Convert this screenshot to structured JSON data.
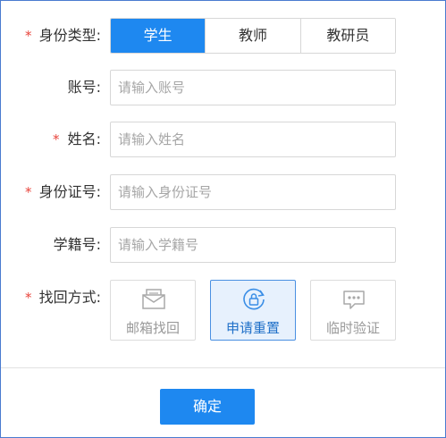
{
  "form": {
    "identity_type": {
      "label": "身份类型:",
      "required": "*",
      "options": [
        "学生",
        "教师",
        "教研员"
      ],
      "selected": "学生"
    },
    "account": {
      "label": "账号:",
      "placeholder": "请输入账号",
      "value": ""
    },
    "name": {
      "label": "姓名:",
      "required": "*",
      "placeholder": "请输入姓名",
      "value": ""
    },
    "id_number": {
      "label": "身份证号:",
      "required": "*",
      "placeholder": "请输入身份证号",
      "value": ""
    },
    "student_number": {
      "label": "学籍号:",
      "placeholder": "请输入学籍号",
      "value": ""
    },
    "recovery_method": {
      "label": "找回方式:",
      "required": "*",
      "options": [
        {
          "label": "邮箱找回",
          "icon": "mail-icon"
        },
        {
          "label": "申请重置",
          "icon": "lock-reset-icon"
        },
        {
          "label": "临时验证",
          "icon": "chat-bubble-icon"
        }
      ],
      "selected": "申请重置"
    }
  },
  "actions": {
    "confirm_label": "确定"
  },
  "colors": {
    "accent": "#1e88f0",
    "required_star": "#e8453c",
    "active_card_bg": "#e7f1fd",
    "frame_border": "#4a7bd0"
  }
}
